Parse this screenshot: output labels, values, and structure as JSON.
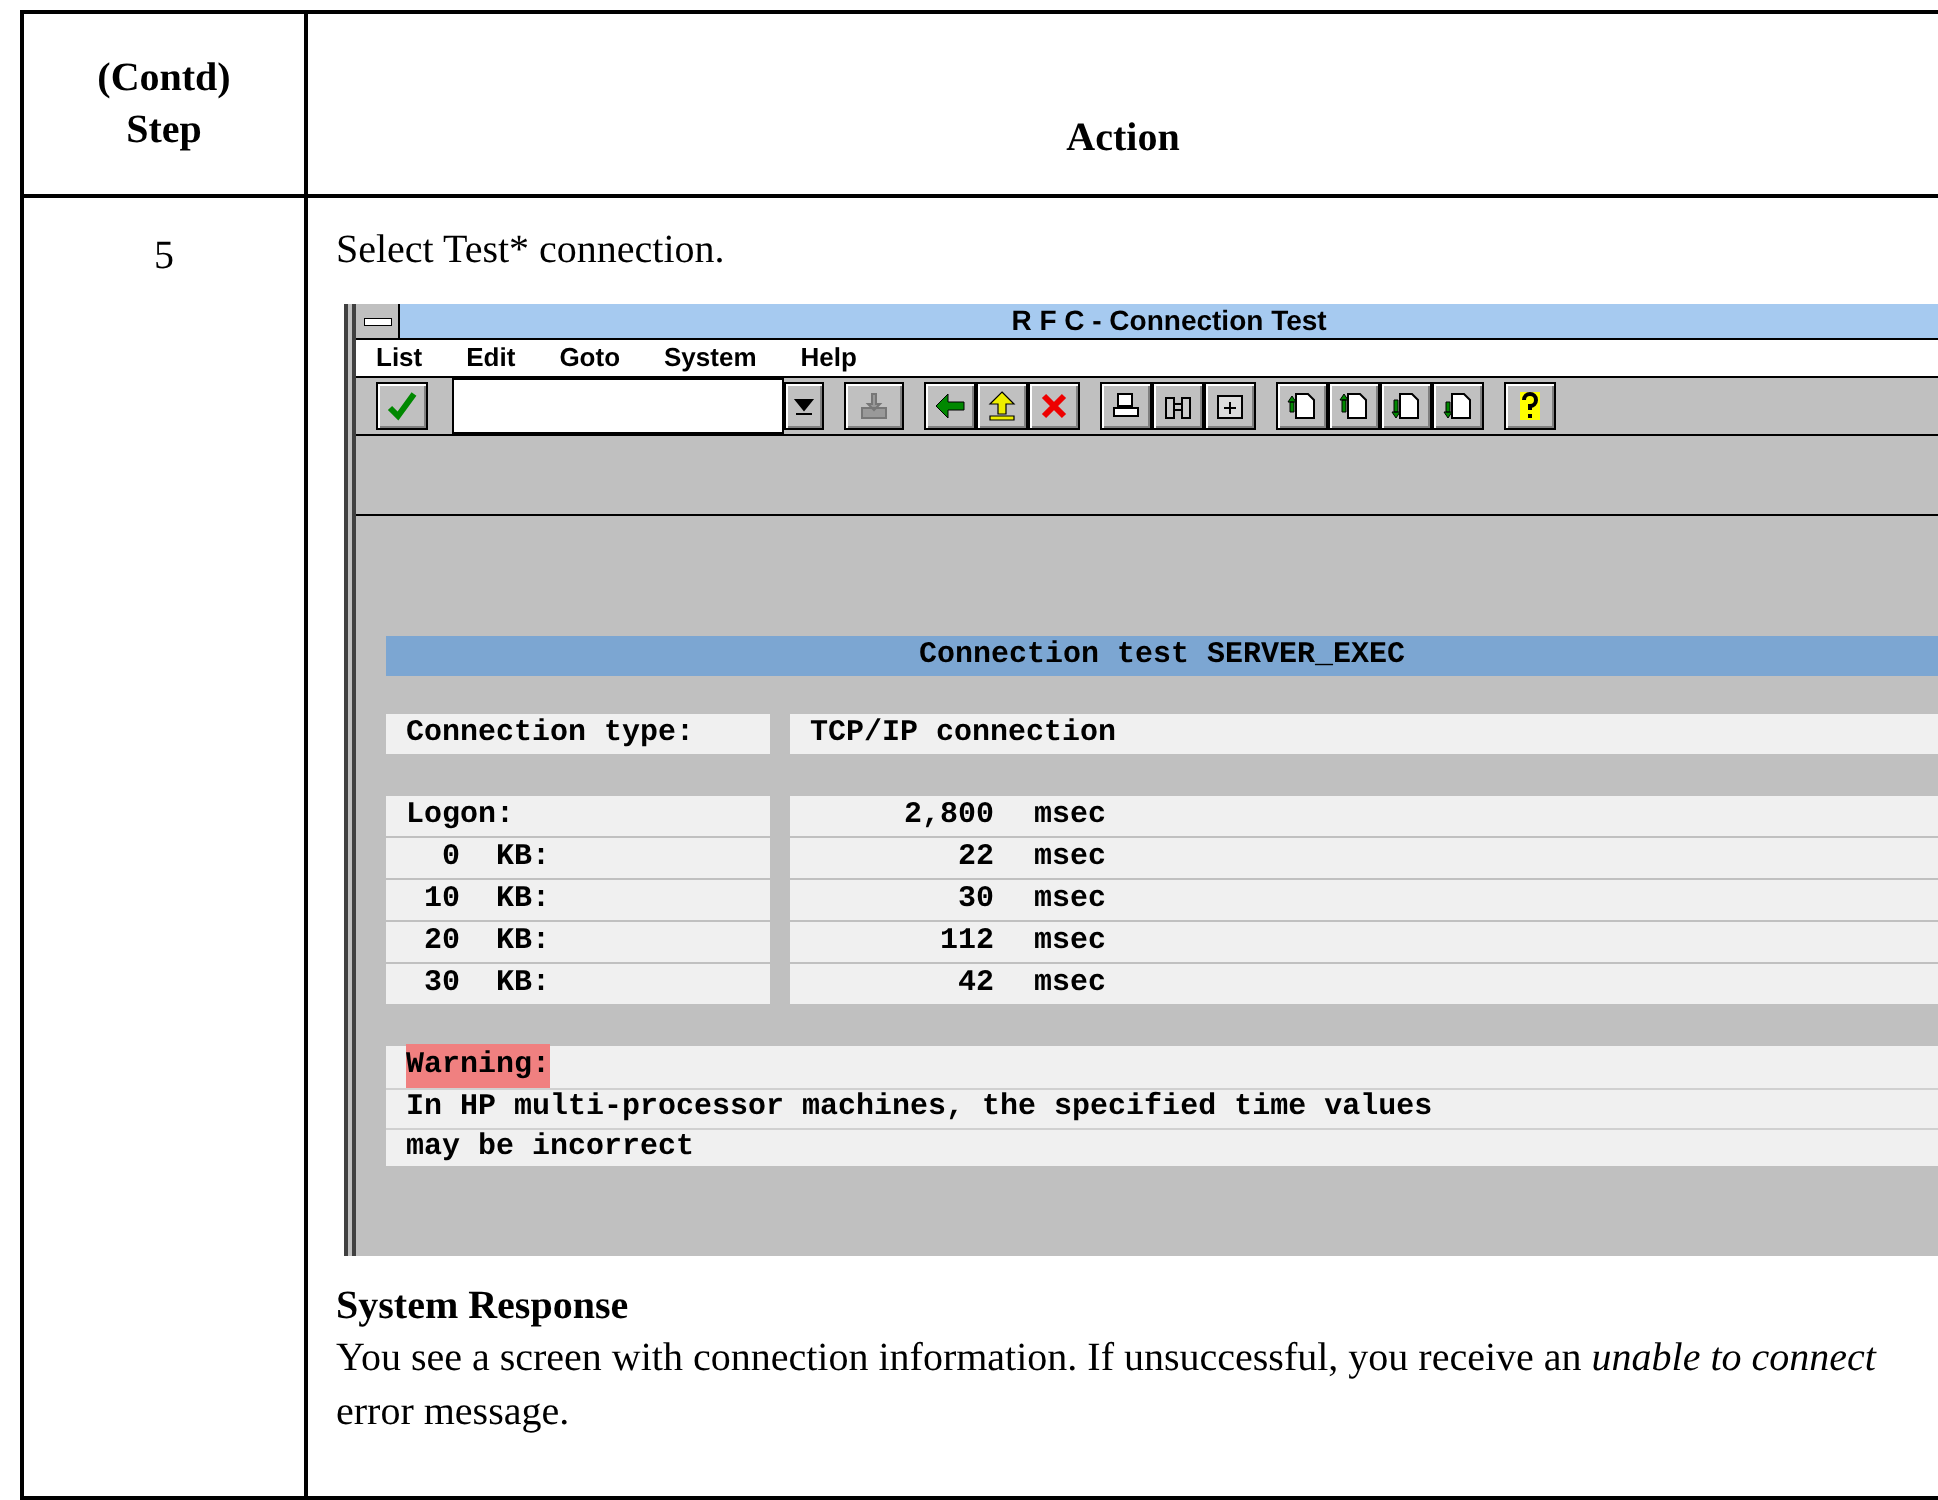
{
  "table": {
    "columns": [
      "(Contd) Step",
      "Action"
    ],
    "rows": [
      {
        "step": "5",
        "instruction": "Select Test* connection.",
        "screenshot": {
          "title": "R F C - Connection Test",
          "menu": [
            "List",
            "Edit",
            "Goto",
            "System",
            "Help"
          ],
          "list_title": "Connection test SERVER_EXEC",
          "connection_type": {
            "label": "Connection type:",
            "value": "TCP/IP connection"
          },
          "timings": [
            {
              "kind": "total",
              "label": "Logon:",
              "value": "2,800",
              "unit": "msec"
            },
            {
              "kind": "size",
              "size": "0",
              "label": "KB:",
              "value": "22",
              "unit": "msec"
            },
            {
              "kind": "size",
              "size": "10",
              "label": "KB:",
              "value": "30",
              "unit": "msec"
            },
            {
              "kind": "size",
              "size": "20",
              "label": "KB:",
              "value": "112",
              "unit": "msec"
            },
            {
              "kind": "size",
              "size": "30",
              "label": "KB:",
              "value": "42",
              "unit": "msec"
            }
          ],
          "warning": {
            "label": "Warning:",
            "lines": [
              "In HP multi-processor machines, the specified time values",
              "may be incorrect"
            ]
          }
        },
        "response_heading": "System Response",
        "response_text": "You see a screen with connection information. If unsuccessful, you receive an *unable to connect* error message."
      }
    ]
  }
}
